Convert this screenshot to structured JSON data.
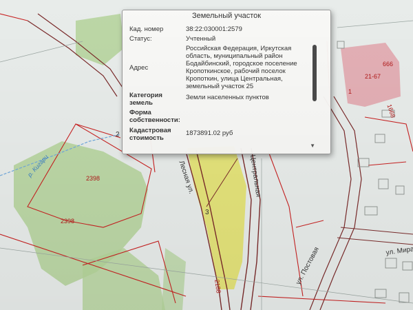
{
  "popup": {
    "title": "Земельный участок",
    "rows": [
      {
        "key": "Кад. номер",
        "value": "38:22:030001:2579"
      },
      {
        "key": "Статус:",
        "value": "Учтенный"
      },
      {
        "key": "Адрес",
        "value": "Российская Федерация, Иркутская область, муниципальный район Бодайбинский, городское поселение Кропоткинское, рабочий поселок Кропоткин, улица Центральная, земельный участок 25"
      },
      {
        "key": "Категория земель",
        "value": "Земли населенных пунктов"
      },
      {
        "key": "Форма собственности:",
        "value": ""
      },
      {
        "key": "Кадастровая стоимость",
        "value": "1873891.02 руб"
      }
    ]
  },
  "map": {
    "labels": {
      "parcel_2398_a": "2398",
      "parcel_2398_b": "2398",
      "parcel_2188": "2188",
      "parcel_21_67": "21-67",
      "parcel_666": "666",
      "parcel_1668": "1668",
      "parcel_1": "1",
      "river": "р. Кигари",
      "street_mira": "ул. Мира",
      "street_postovaya": "ул. Постовая",
      "street_left": "Лесная ул.",
      "street_central": "Центральная",
      "small_2": "2",
      "small_3": "3"
    }
  },
  "colors": {
    "green_area": "#b4d49a",
    "yellow_parcel": "#e3e26e",
    "pink_building": "#e2a5ac",
    "parcel_line": "#c82020",
    "river": "#6fa8dc"
  }
}
